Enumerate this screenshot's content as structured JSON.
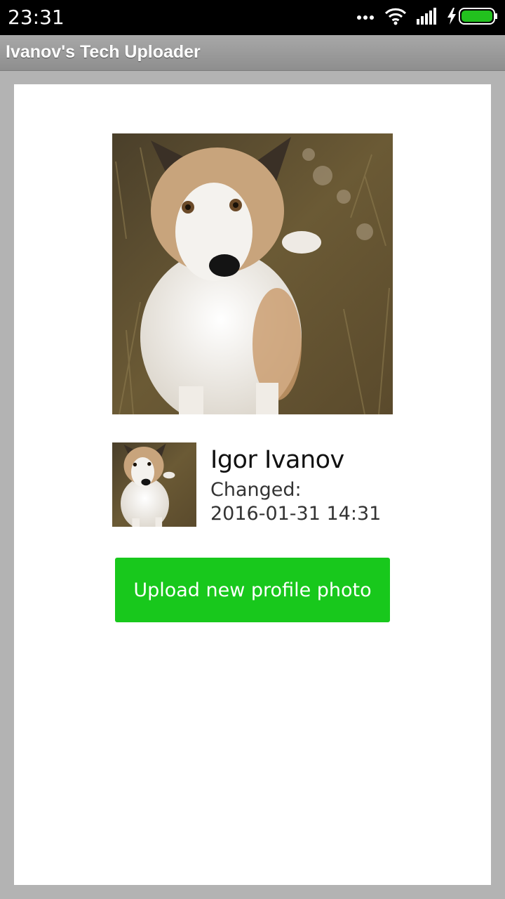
{
  "status_bar": {
    "time": "23:31",
    "icons": [
      "more-dots-icon",
      "wifi-icon",
      "signal-icon",
      "charging-bolt-icon",
      "battery-icon"
    ],
    "battery_color": "#22c11e"
  },
  "app_bar": {
    "title": "Ivanov's Tech Uploader"
  },
  "profile": {
    "name": "Igor Ivanov",
    "changed_label": "Changed:",
    "changed_date": "2016-01-31 14:31",
    "photo_subject": "dog-photo"
  },
  "actions": {
    "upload_label": "Upload new profile photo",
    "accent_color": "#18c81c"
  }
}
